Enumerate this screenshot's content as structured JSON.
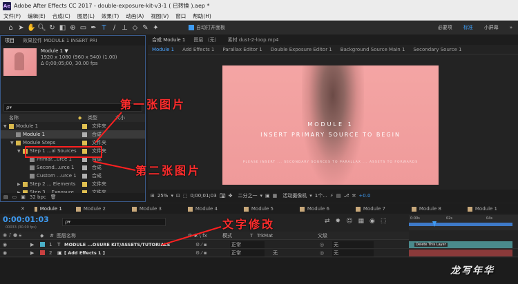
{
  "window": {
    "title": "Adobe After Effects CC 2017 - double-exposure-kit-v3-1 ( 已转换 ).aep *",
    "logo": "Ae"
  },
  "menu": [
    "文件(F)",
    "编辑(E)",
    "合成(C)",
    "图层(L)",
    "效果(T)",
    "动画(A)",
    "视图(V)",
    "窗口",
    "帮助(H)"
  ],
  "toolbar": {
    "auto_open": "自动打开面板",
    "workspaces": [
      "必要项",
      "标准",
      "小屏幕"
    ],
    "active_workspace": "标准"
  },
  "project": {
    "tab_project": "项目",
    "tab_effects": "效果控件 MODULE 1 INSERT PRI",
    "item_name": "Module 1 ▼",
    "item_info1": "1920 x 1080 (960 x 540) (1.00)",
    "item_info2": "Δ 0;00;05;00, 30.00 fps",
    "search_placeholder": "ρ▾",
    "col_name": "名称",
    "col_type": "类型",
    "col_size": "大小",
    "rows": [
      {
        "name": "Module 1",
        "type": "文件夹",
        "indent": 0,
        "arrow": "▼",
        "color": "#e0c050",
        "icon": "folder"
      },
      {
        "name": "Module 1",
        "type": "合成",
        "indent": 1,
        "arrow": "",
        "color": "#b0b0b0",
        "icon": "comp",
        "selected": true
      },
      {
        "name": "Module Steps",
        "type": "文件夹",
        "indent": 1,
        "arrow": "▼",
        "color": "#e0c050",
        "icon": "folder"
      },
      {
        "name": "Step 1 ...al Sources",
        "type": "文件夹",
        "indent": 2,
        "arrow": "▼",
        "color": "#e0c050",
        "icon": "folder"
      },
      {
        "name": "Primar...urce 1",
        "type": "合成",
        "indent": 3,
        "arrow": "",
        "color": "#b0b0b0",
        "icon": "comp",
        "boxed": true
      },
      {
        "name": "Second...urce 1",
        "type": "合成",
        "indent": 3,
        "arrow": "",
        "color": "#b0b0b0",
        "icon": "comp"
      },
      {
        "name": "Custom ...urce 1",
        "type": "合成",
        "indent": 3,
        "arrow": "",
        "color": "#b0b0b0",
        "icon": "comp"
      },
      {
        "name": "Step 2 ... Elements",
        "type": "文件夹",
        "indent": 2,
        "arrow": "▶",
        "color": "#e0c050",
        "icon": "folder"
      },
      {
        "name": "Step 3... Exposure",
        "type": "文件夹",
        "indent": 2,
        "arrow": "▶",
        "color": "#e0c050",
        "icon": "folder"
      }
    ],
    "bpc": "32 bpc"
  },
  "annotations": {
    "first": "第一张图片",
    "second": "第二张图片",
    "text_edit": "文字修改"
  },
  "composition": {
    "tab_comp": "合成 Module 1",
    "tab_layer": "图层 （无）",
    "tab_footage": "素材 dust-2-loop.mp4",
    "breadcrumbs": [
      "Module 1",
      "Add Effects 1",
      "Parallax Editor 1",
      "Double Exposure Editor 1",
      "Background Source Main 1",
      "Secondary Source 1"
    ],
    "preview_title": "MODULE 1",
    "preview_subtitle": "INSERT PRIMARY SOURCE TO BEGIN",
    "preview_small": "PLEASE INSERT ... SECONDARY SOURCES TO PARALLAX ... ASSETS TO FORWARDS",
    "zoom": "25%",
    "timecode": "0;00;01;03",
    "resolution": "二分之一",
    "camera": "活动摄像机",
    "views": "1个...",
    "exposure": "+0.0"
  },
  "timeline": {
    "tabs": [
      {
        "label": "Module 1",
        "color": "#c8a87a"
      },
      {
        "label": "Module 2",
        "color": "#c8a87a"
      },
      {
        "label": "Module 3",
        "color": "#c8a87a"
      },
      {
        "label": "Module 4",
        "color": "#c8a87a"
      },
      {
        "label": "Module 5",
        "color": "#c8a87a"
      },
      {
        "label": "Module 6",
        "color": "#c8a87a"
      },
      {
        "label": "Module 7",
        "color": "#c8a87a"
      },
      {
        "label": "Module 8",
        "color": "#c8a87a"
      },
      {
        "label": "Module 1",
        "color": "#c8a87a"
      }
    ],
    "timecode": "0:00:01:03",
    "timecode_sub": "00033 (30.00 fps)",
    "search_placeholder": "ρ▾",
    "col_layer": "图层名称",
    "col_mode": "模式",
    "col_t": "T",
    "col_trkmat": "TrkMat",
    "col_parent": "父级",
    "ruler": [
      "0:00s",
      "02s",
      "04s"
    ],
    "layers": [
      {
        "num": "1",
        "color": "#4ab0c8",
        "icon": "T",
        "name": "MODULE ...OSURE KIT/ASSETS/TUTORIALS",
        "mode": "正常",
        "trkmat": "",
        "parent": "无",
        "bar_label": "Delete This Layer"
      },
      {
        "num": "2",
        "color": "#c84040",
        "icon": "▣",
        "name": "[ Add Effects 1 ]",
        "mode": "正常",
        "trkmat": "无",
        "parent": "无",
        "bar_label": ""
      }
    ]
  },
  "watermark": "龙写年华"
}
